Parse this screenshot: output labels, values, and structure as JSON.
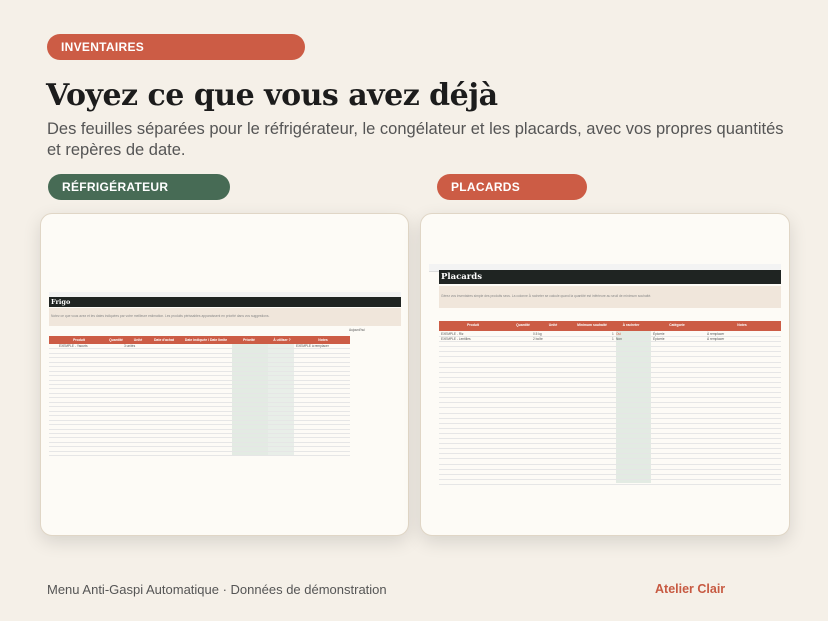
{
  "badge": {
    "label": "INVENTAIRES",
    "color": "#cc5c45"
  },
  "heading": "Voyez ce que vous avez déjà",
  "subtitle": "Des feuilles séparées pour le réfrigérateur, le congélateur et les placards, avec vos propres quantités et repères de date.",
  "cards": [
    {
      "tab_label": "RÉFRIGÉRATEUR",
      "tab_color": "#476b55",
      "sheet_title": "Frigo",
      "description": "Notez ce que vous avez et les dates indiquées par votre meilleure estimation. Les produits périssables apparaissent en priorité dans vos suggestions.",
      "columns": [
        "Produit",
        "Quantité",
        "Unité",
        "Date d'achat",
        "Date indiquée / Date limite",
        "Priorité",
        "À utiliser ?",
        "Notes"
      ],
      "aside_label": "Aujourd'hui",
      "example_row": [
        "EXEMPLE - Yaourts",
        "",
        "3 unités",
        "",
        "",
        "",
        "",
        "EXEMPLE à remplacer"
      ]
    },
    {
      "tab_label": "PLACARDS",
      "tab_color": "#cc5c45",
      "sheet_title": "Placards",
      "description": "Gérez vos inventaires simple des produits secs. La colonne À racheter se calcule quand la quantité est inférieure au seuil de minimum souhaité.",
      "columns": [
        "Produit",
        "Quantité",
        "Unité",
        "Minimum souhaité",
        "À racheter",
        "Catégorie",
        "Notes"
      ],
      "example_rows": [
        [
          "EXEMPLE - Riz",
          "0.5 kg",
          "",
          "1",
          "Oui",
          "Épicerie",
          "À remplacer"
        ],
        [
          "EXEMPLE - Lentilles",
          "2 boîte",
          "",
          "1",
          "Non",
          "Épicerie",
          "À remplacer"
        ]
      ]
    }
  ],
  "footer": {
    "left": "Menu Anti-Gaspi Automatique · Données de démonstration",
    "right": "Atelier Clair"
  }
}
